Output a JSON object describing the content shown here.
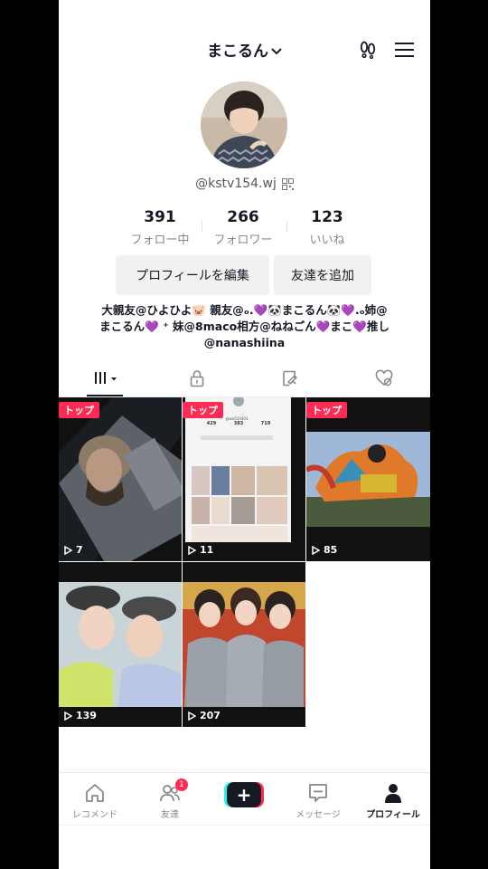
{
  "header": {
    "username": "まこるん"
  },
  "profile": {
    "handle": "@kstv154.wj",
    "stats": [
      {
        "value": "391",
        "label": "フォロー中"
      },
      {
        "value": "266",
        "label": "フォロワー"
      },
      {
        "value": "123",
        "label": "いいね"
      }
    ],
    "edit_button": "プロフィールを編集",
    "add_friend_button": "友達を追加",
    "bio": {
      "line1": "大親友@ひよひよ🐷 親友@ₒ.💜🐼まこるん🐼💜.ₒ姉@",
      "line2": "まこるん💜 ⁺ 妹@8maco相方@ねねごん💜まこ💜推し",
      "line3": "@nanashiina"
    }
  },
  "videos": [
    {
      "badge": "トップ",
      "views": "7"
    },
    {
      "badge": "トップ",
      "views": "11"
    },
    {
      "badge": "トップ",
      "views": "85"
    },
    {
      "badge": "",
      "views": "139"
    },
    {
      "badge": "",
      "views": "207"
    }
  ],
  "nav": {
    "home": "レコメンド",
    "friends": "友達",
    "friends_badge": "1",
    "create": "+",
    "inbox": "メッセージ",
    "profile": "プロフィール"
  },
  "thumb_mini": {
    "stats": [
      "429",
      "383",
      "719"
    ],
    "handle": "@wa510403"
  },
  "colors": {
    "accent": "#fe2c55",
    "cyan": "#25f4ee",
    "text": "#161823",
    "muted": "#888888"
  }
}
